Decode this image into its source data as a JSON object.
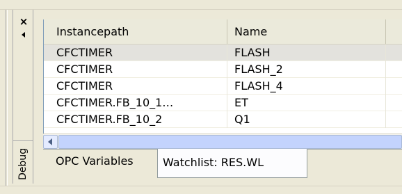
{
  "side_panel": {
    "label": "Debug",
    "close_symbol": "×"
  },
  "grid": {
    "columns": [
      "Instancepath",
      "Name",
      ""
    ],
    "rows": [
      {
        "instancepath": "CFCTIMER",
        "name": "FLASH",
        "selected": true
      },
      {
        "instancepath": "CFCTIMER",
        "name": "FLASH_2",
        "selected": false
      },
      {
        "instancepath": "CFCTIMER",
        "name": "FLASH_4",
        "selected": false
      },
      {
        "instancepath": "CFCTIMER.FB_10_1…",
        "name": "ET",
        "selected": false
      },
      {
        "instancepath": "CFCTIMER.FB_10_2",
        "name": "Q1",
        "selected": false
      }
    ]
  },
  "tabs": [
    {
      "label": "OPC Variables",
      "active": false
    },
    {
      "label": "Watchlist: RES.WL",
      "active": true
    }
  ]
}
